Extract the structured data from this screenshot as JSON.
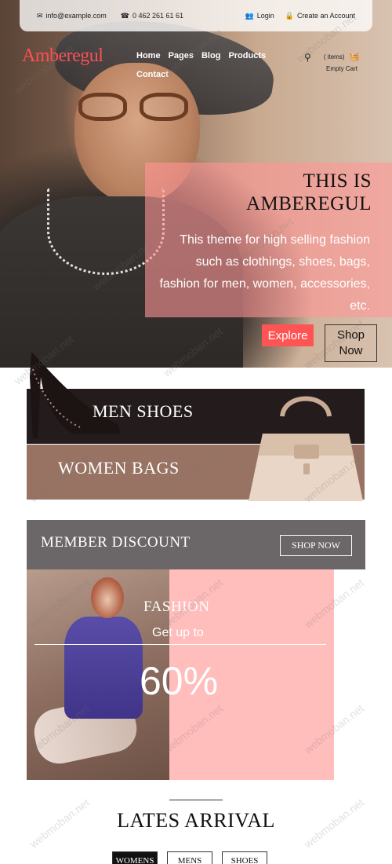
{
  "topbar": {
    "email": "info@example.com",
    "phone": "0 462 261 61 61",
    "login": "Login",
    "create_account": "Create an Account"
  },
  "brand": {
    "logo": "Amberegul"
  },
  "nav": {
    "home": "Home",
    "pages": "Pages",
    "blog": "Blog",
    "products": "Products",
    "contact": "Contact"
  },
  "cart": {
    "items": "( items)",
    "empty": "Empty Cart"
  },
  "hero": {
    "title_line1": "THIS IS",
    "title_line2": "AMBEREGUL",
    "text": "This theme for high selling fashion such as clothings, shoes, bags, fashion for men, women, accessories, etc.",
    "explore": "Explore",
    "shop_line1": "Shop",
    "shop_line2": "Now"
  },
  "categories": {
    "men_shoes": "MEN SHOES",
    "women_bags": "WOMEN BAGS"
  },
  "member": {
    "title": "MEMBER DISCOUNT",
    "button": "SHOP NOW"
  },
  "promo": {
    "label": "FASHION",
    "get": "Get up to",
    "percent": "60%"
  },
  "arrival": {
    "title": "LATES ARRIVAL",
    "tabs": [
      "WOMENS",
      "MENS",
      "SHOES"
    ]
  },
  "watermark": {
    "text": "webmoban.net"
  },
  "colors": {
    "accent": "#ff4f55",
    "explore": "#ff5454",
    "panel": "#ff9696",
    "promo_bg": "#ffbdbc",
    "member_band": "#6b6768"
  }
}
